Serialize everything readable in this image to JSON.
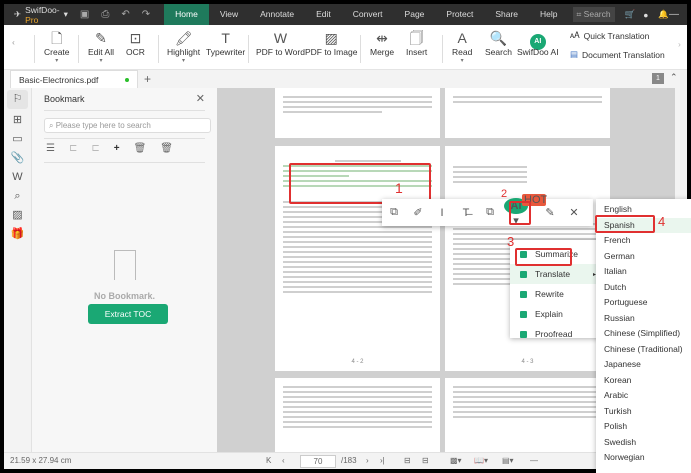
{
  "app": {
    "name_prefix": "SwifDoo-",
    "name_suffix": "Pro"
  },
  "menu": [
    "Home",
    "View",
    "Annotate",
    "Edit",
    "Convert",
    "Page",
    "Protect",
    "Share",
    "Help"
  ],
  "title_search": "Search",
  "ribbon": {
    "create": "Create",
    "edit_all": "Edit All",
    "ocr": "OCR",
    "highlight": "Highlight",
    "typewriter": "Typewriter",
    "pdf_to_word": "PDF to Word",
    "pdf_to_image": "PDF to Image",
    "merge": "Merge",
    "insert": "Insert",
    "read": "Read",
    "search": "Search",
    "swifdoo_ai": "SwifDoo AI",
    "quick_translation": "Quick Translation",
    "document_translation": "Document Translation"
  },
  "tab": {
    "filename": "Basic-Electronics.pdf",
    "page_badge": "1"
  },
  "bookmark": {
    "title": "Bookmark",
    "search_placeholder": "Please type here to search",
    "empty": "No Bookmark.",
    "extract": "Extract TOC"
  },
  "pages": {
    "labels": [
      "4 - 2",
      "4 - 3"
    ]
  },
  "status": {
    "size": "21.59 x 27.94 cm",
    "page": "70",
    "total": "/183"
  },
  "ai_badge": "HOT",
  "ai_label": "AI",
  "ai_menu": [
    "Summarize",
    "Translate",
    "Rewrite",
    "Explain",
    "Proofread"
  ],
  "languages": [
    "English",
    "Spanish",
    "French",
    "German",
    "Italian",
    "Dutch",
    "Portuguese",
    "Russian",
    "Chinese (Simplified)",
    "Chinese (Traditional)",
    "Japanese",
    "Korean",
    "Arabic",
    "Turkish",
    "Polish",
    "Swedish",
    "Norwegian"
  ],
  "steps": [
    "1",
    "2",
    "3",
    "4"
  ],
  "colors": {
    "accent": "#1aa874",
    "annotation": "#e03030",
    "titlebar": "#2f2f2f"
  }
}
